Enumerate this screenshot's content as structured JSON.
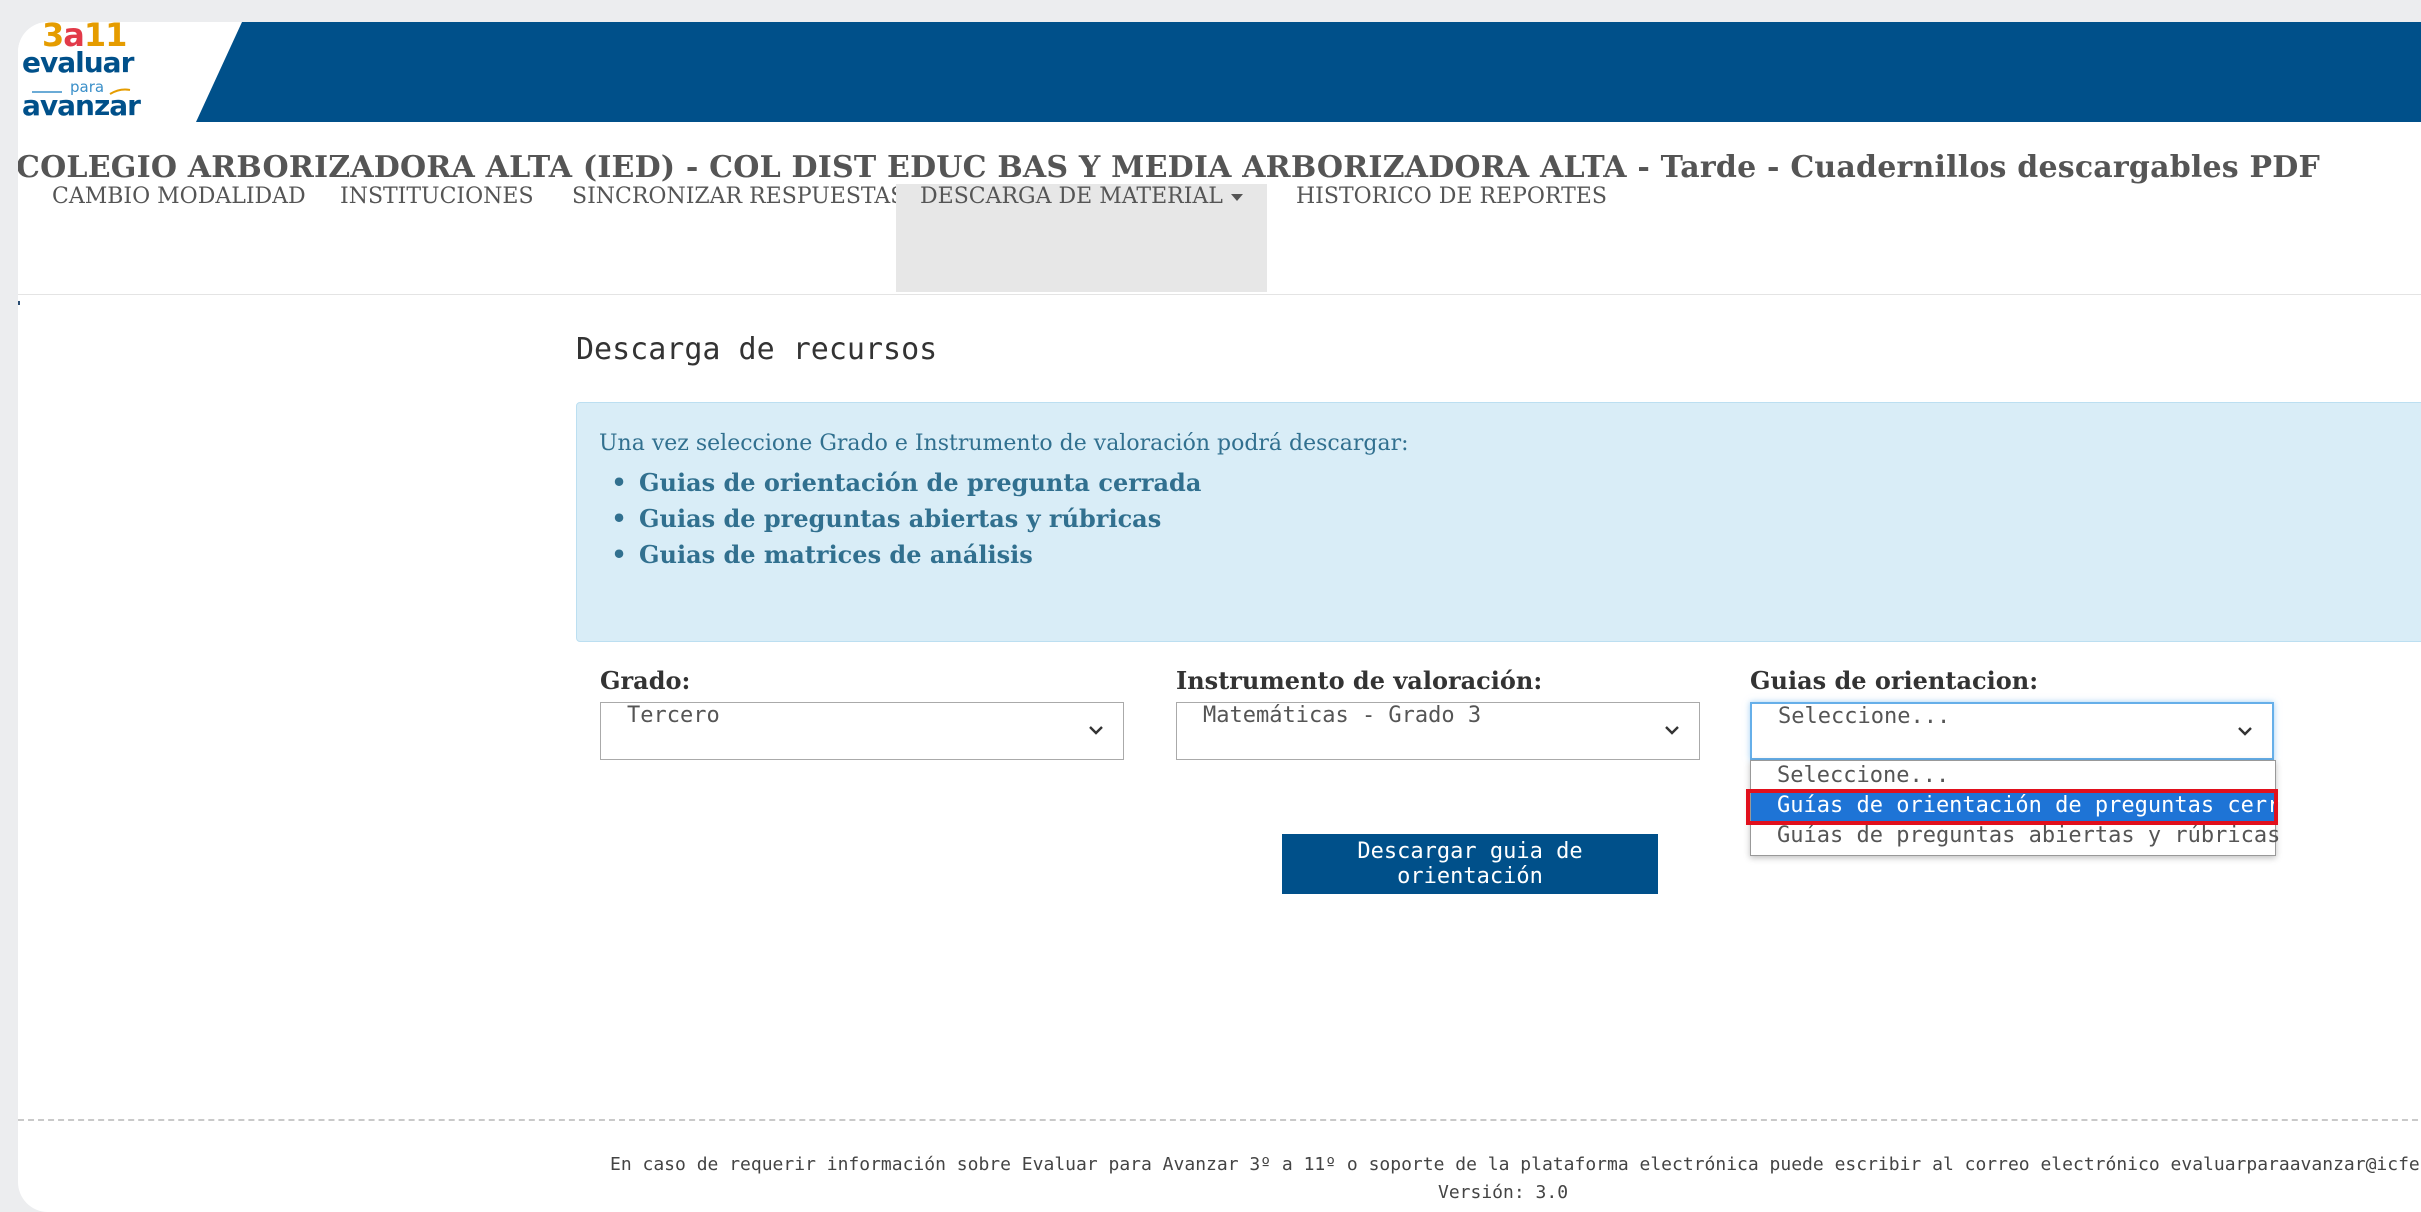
{
  "brand": {
    "logo_number_3": "3",
    "logo_number_a": "a",
    "logo_number_11": "11",
    "logo_line1": "evaluar",
    "logo_line2": "para",
    "logo_line3": "avanzar",
    "header_color": "#00508a"
  },
  "page_title": "COLEGIO ARBORIZADORA ALTA (IED) - COL DIST EDUC BAS Y MEDIA ARBORIZADORA ALTA - Tarde - Cuadernillos descargables PDF",
  "nav": {
    "items": [
      {
        "label": "CAMBIO MODALIDAD"
      },
      {
        "label": "INSTITUCIONES"
      },
      {
        "label": "SINCRONIZAR RESPUESTAS"
      },
      {
        "label": "DESCARGA DE MATERIAL"
      },
      {
        "label": "HISTORICO DE REPORTES"
      }
    ],
    "active_index": 3
  },
  "section_title": "Descarga de recursos",
  "info": {
    "intro": "Una vez seleccione Grado e Instrumento de valoración podrá descargar:",
    "items": [
      "Guias de orientación de pregunta cerrada",
      "Guias de preguntas abiertas y rúbricas",
      "Guias de matrices de análisis"
    ]
  },
  "form": {
    "grado": {
      "label": "Grado:",
      "value": "Tercero"
    },
    "instrumento": {
      "label": "Instrumento de valoración:",
      "value": "Matemáticas - Grado 3"
    },
    "guias": {
      "label": "Guias de orientacion:",
      "value": "Seleccione...",
      "options": [
        "Seleccione...",
        "Guías de orientación de preguntas cerradas",
        "Guías de preguntas abiertas y rúbricas"
      ],
      "highlighted_index": 1
    },
    "download_label": "Descargar guia de orientación"
  },
  "footer": {
    "contact": "En caso de requerir información sobre Evaluar para Avanzar 3º a 11º o soporte de la plataforma electrónica puede escribir al correo electrónico evaluarparaavanzar@icfes.gov.co",
    "version": "Versión: 3.0"
  }
}
